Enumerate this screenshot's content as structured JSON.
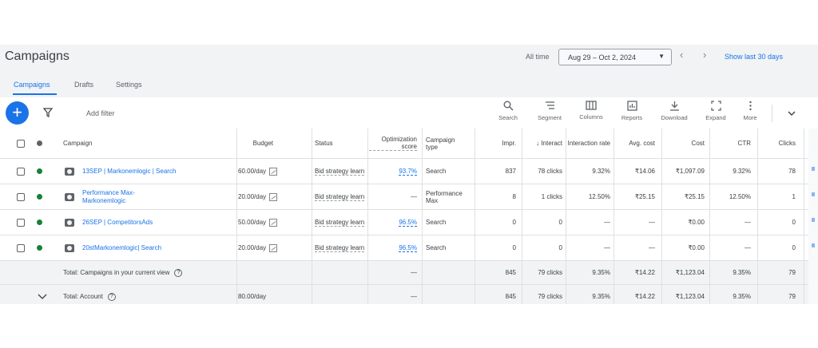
{
  "header": {
    "title": "Campaigns",
    "time_label": "All time",
    "date_range": "Aug 29 – Oct 2, 2024",
    "show_last": "Show last 30 days"
  },
  "tabs": [
    {
      "label": "Campaigns",
      "active": true
    },
    {
      "label": "Drafts",
      "active": false
    },
    {
      "label": "Settings",
      "active": false
    }
  ],
  "toolbar": {
    "add_filter": "Add filter",
    "tools": [
      {
        "label": "Search",
        "icon": "search-icon"
      },
      {
        "label": "Segment",
        "icon": "segment-icon"
      },
      {
        "label": "Columns",
        "icon": "columns-icon"
      },
      {
        "label": "Reports",
        "icon": "reports-icon"
      },
      {
        "label": "Download",
        "icon": "download-icon"
      },
      {
        "label": "Expand",
        "icon": "expand-icon"
      },
      {
        "label": "More",
        "icon": "more-vert-icon"
      }
    ]
  },
  "table": {
    "columns": [
      "Campaign",
      "Budget",
      "Status",
      "Optimization score",
      "Campaign type",
      "Impr.",
      "↓ Interact",
      "Interaction rate",
      "Avg. cost",
      "Cost",
      "CTR",
      "Clicks"
    ],
    "rows": [
      {
        "campaign": "13SEP | Markonemlogic | Search",
        "budget": "60.00/day",
        "status": "Bid strategy learn",
        "opt_score": "93.7%",
        "type": "Search",
        "impr": "837",
        "interactions": "78 clicks",
        "interaction_rate": "9.32%",
        "avg_cost": "₹14.06",
        "cost": "₹1,097.09",
        "ctr": "9.32%",
        "clicks": "78"
      },
      {
        "campaign": "Performance Max- Markonemlogic",
        "budget": "20.00/day",
        "status": "Bid strategy learn",
        "opt_score": "—",
        "type": "Performance Max",
        "impr": "8",
        "interactions": "1 clicks",
        "interaction_rate": "12.50%",
        "avg_cost": "₹25.15",
        "cost": "₹25.15",
        "ctr": "12.50%",
        "clicks": "1"
      },
      {
        "campaign": "26SEP | CompetitorsAds",
        "budget": "50.00/day",
        "status": "Bid strategy learn",
        "opt_score": "96.5%",
        "type": "Search",
        "impr": "0",
        "interactions": "0",
        "interaction_rate": "—",
        "avg_cost": "—",
        "cost": "₹0.00",
        "ctr": "—",
        "clicks": "0"
      },
      {
        "campaign": "20stMarkonemlogic| Search",
        "budget": "20.00/day",
        "status": "Bid strategy learn",
        "opt_score": "96.5%",
        "type": "Search",
        "impr": "0",
        "interactions": "0",
        "interaction_rate": "—",
        "avg_cost": "—",
        "cost": "₹0.00",
        "ctr": "—",
        "clicks": "0"
      }
    ],
    "totals": [
      {
        "label": "Total: Campaigns in your current view",
        "budget": "",
        "opt_score": "—",
        "impr": "845",
        "interactions": "79 clicks",
        "interaction_rate": "9.35%",
        "avg_cost": "₹14.22",
        "cost": "₹1,123.04",
        "ctr": "9.35%",
        "clicks": "79"
      },
      {
        "label": "Total: Account",
        "budget": "80.00/day",
        "opt_score": "—",
        "impr": "845",
        "interactions": "79 clicks",
        "interaction_rate": "9.35%",
        "avg_cost": "₹14.22",
        "cost": "₹1,123.04",
        "ctr": "9.35%",
        "clicks": "79"
      }
    ]
  },
  "colors": {
    "accent": "#1a73e8",
    "enabled": "#188038",
    "background": "#f1f3f4"
  }
}
